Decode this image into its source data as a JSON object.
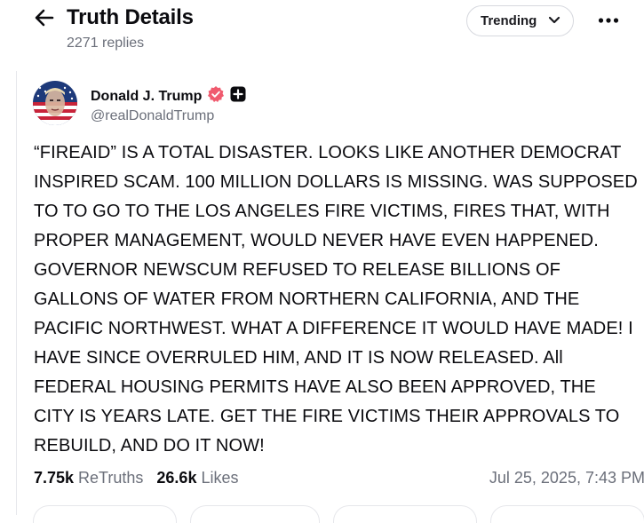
{
  "header": {
    "title": "Truth Details",
    "reply_count": "2271 replies",
    "sort_label": "Trending"
  },
  "post": {
    "author": {
      "display_name": "Donald J. Trump",
      "handle": "@realDonaldTrump",
      "verified": true
    },
    "text": "“FIREAID” IS A TOTAL DISASTER. LOOKS LIKE ANOTHER DEMOCRAT INSPIRED SCAM. 100 MILLION DOLLARS IS MISSING. WAS SUPPOSED TO TO GO TO THE LOS ANGELES FIRE VICTIMS, FIRES THAT, WITH PROPER MANAGEMENT, WOULD NEVER HAVE EVEN HAPPENED. GOVERNOR NEWSCUM REFUSED TO RELEASE BILLIONS OF GALLONS OF WATER FROM NORTHERN CALIFORNIA, AND THE PACIFIC NORTHWEST. WHAT A DIFFERENCE IT WOULD HAVE MADE! I HAVE SINCE OVERRULED HIM, AND IT IS NOW RELEASED. All FEDERAL HOUSING PERMITS HAVE ALSO BEEN APPROVED, THE CITY IS YEARS LATE. GET THE FIRE VICTIMS THEIR APPROVALS TO REBUILD, AND DO IT NOW!",
    "stats": {
      "retruths_count": "7.75k",
      "retruths_label": "ReTruths",
      "likes_count": "26.6k",
      "likes_label": "Likes"
    },
    "timestamp": "Jul 25, 2025, 7:43 PM"
  },
  "icons": {
    "back": "arrow-left-icon",
    "sort_chevron": "chevron-down-icon",
    "more": "more-horizontal-icon",
    "verified": "verified-badge-icon",
    "plus": "plus-badge-icon"
  },
  "colors": {
    "verified_badge": "#f05a6e",
    "secondary_text": "#6b6f7a",
    "primary_text": "#0b0b0f",
    "border": "#e6e7eb"
  }
}
